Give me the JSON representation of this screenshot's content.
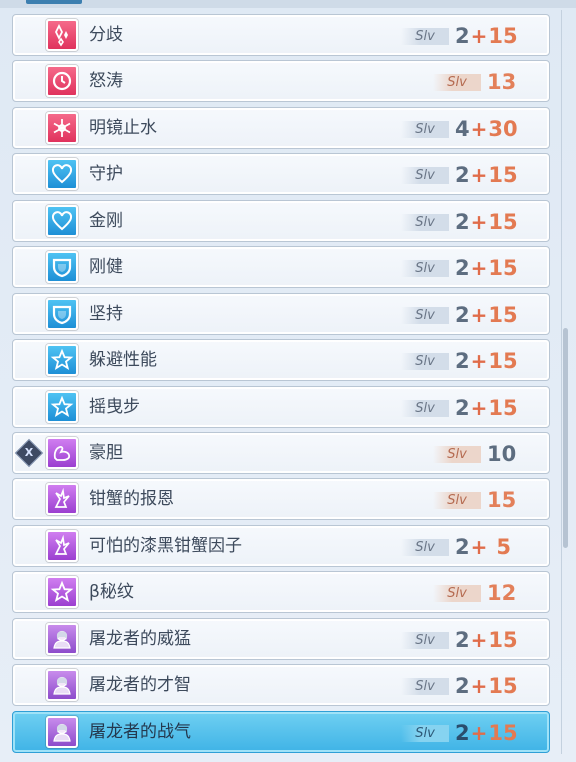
{
  "skills": [
    {
      "name": "分歧",
      "slv_label": "Slv",
      "base": "2",
      "plus": "+",
      "bonus": "15",
      "icon": "diamond-sparkle-icon",
      "color": "red"
    },
    {
      "name": "怒涛",
      "slv_label": "Slv",
      "base": "",
      "plus": "",
      "bonus": "13",
      "icon": "clock-icon",
      "color": "red"
    },
    {
      "name": "明镜止水",
      "slv_label": "Slv",
      "base": "4",
      "plus": "+",
      "bonus": "30",
      "icon": "snowflake-icon",
      "color": "red"
    },
    {
      "name": "守护",
      "slv_label": "Slv",
      "base": "2",
      "plus": "+",
      "bonus": "15",
      "icon": "heart-icon",
      "color": "blue"
    },
    {
      "name": "金刚",
      "slv_label": "Slv",
      "base": "2",
      "plus": "+",
      "bonus": "15",
      "icon": "heart-icon",
      "color": "blue"
    },
    {
      "name": "刚健",
      "slv_label": "Slv",
      "base": "2",
      "plus": "+",
      "bonus": "15",
      "icon": "shield-icon",
      "color": "blue"
    },
    {
      "name": "坚持",
      "slv_label": "Slv",
      "base": "2",
      "plus": "+",
      "bonus": "15",
      "icon": "shield-icon",
      "color": "blue"
    },
    {
      "name": "躲避性能",
      "slv_label": "Slv",
      "base": "2",
      "plus": "+",
      "bonus": "15",
      "icon": "star-icon",
      "color": "blue"
    },
    {
      "name": "摇曳步",
      "slv_label": "Slv",
      "base": "2",
      "plus": "+",
      "bonus": "15",
      "icon": "star-icon",
      "color": "blue"
    },
    {
      "name": "豪胆",
      "slv_label": "Slv",
      "base": "",
      "plus": "",
      "bonus": "10",
      "icon": "flexed-arm-icon",
      "color": "purple",
      "tag": "X"
    },
    {
      "name": "钳蟹的报恩",
      "slv_label": "Slv",
      "base": "",
      "plus": "",
      "bonus": "15",
      "icon": "crab-claw-icon",
      "color": "purple"
    },
    {
      "name": "可怕的漆黑钳蟹因子",
      "slv_label": "Slv",
      "base": "2",
      "plus": "+",
      "bonus": "5",
      "icon": "crab-claw-icon",
      "color": "purple"
    },
    {
      "name": "β秘纹",
      "slv_label": "Slv",
      "base": "",
      "plus": "",
      "bonus": "12",
      "icon": "star-icon",
      "color": "purple"
    },
    {
      "name": "屠龙者的威猛",
      "slv_label": "Slv",
      "base": "2",
      "plus": "+",
      "bonus": "15",
      "icon": "character-portrait-icon",
      "color": "char"
    },
    {
      "name": "屠龙者的才智",
      "slv_label": "Slv",
      "base": "2",
      "plus": "+",
      "bonus": "15",
      "icon": "character-portrait-icon",
      "color": "char"
    },
    {
      "name": "屠龙者的战气",
      "slv_label": "Slv",
      "base": "2",
      "plus": "+",
      "bonus": "15",
      "icon": "character-portrait-icon",
      "color": "char",
      "selected": true
    }
  ],
  "colors": {
    "accent_selected": "#3fb3e6",
    "bonus": "#e37a52",
    "text": "#3d4a5c"
  }
}
